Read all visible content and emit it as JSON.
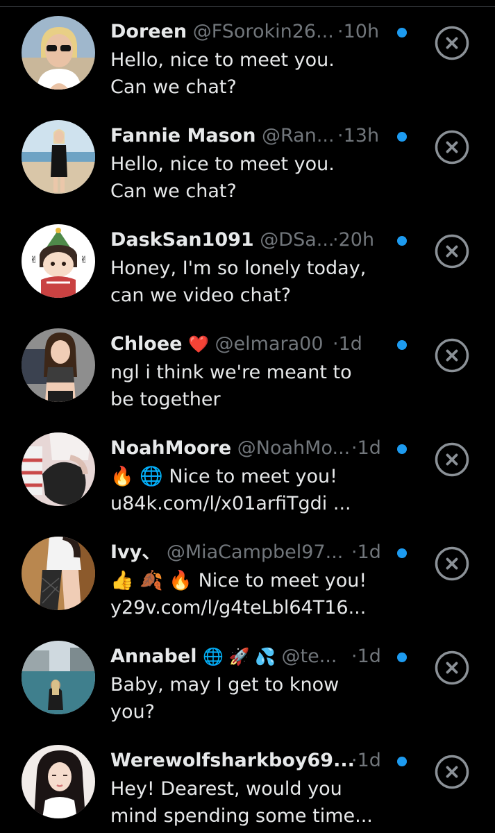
{
  "colors": {
    "background": "#000000",
    "primary_text": "#e7e9ea",
    "secondary_text": "#71767b",
    "unread_dot": "#1d9bf0",
    "close_icon": "#8b9197"
  },
  "icons": {
    "close": "close-circle-x-icon",
    "unread": "unread-dot-icon"
  },
  "requests": [
    {
      "name": "Doreen",
      "handle": "@FSorokin26...",
      "dot": "·",
      "time": "10h",
      "message_line1": "Hello, nice to meet you.",
      "message_line2": "Can we chat?"
    },
    {
      "name": "Fannie Mason",
      "handle": "@Ran...",
      "dot": "·",
      "time": "13h",
      "message_line1": "Hello, nice to meet you.",
      "message_line2": "Can we chat?"
    },
    {
      "name": "DaskSan1091",
      "handle": "@DSa...",
      "dot": "·",
      "time": "20h",
      "message_line1": "Honey, I'm so lonely today,",
      "message_line2": "can we video chat?"
    },
    {
      "name": "Chloee",
      "name_emoji": "❤️",
      "handle": "@elmara00",
      "dot": "·",
      "time": "1d",
      "message_line1": "ngl i think we're meant to",
      "message_line2": "be together"
    },
    {
      "name": "NoahMoore",
      "handle": "@NoahMo...",
      "dot": "·",
      "time": "1d",
      "message_line1": "🔥 🌐 Nice to meet you!",
      "message_line2": "u84k.com/l/x01arfiTgdi ..."
    },
    {
      "name": "Ivy、",
      "handle": "@MiaCampbel97...",
      "dot": "·",
      "time": "1d",
      "message_line1": "👍 🍂 🔥 Nice to meet you!",
      "message_line2": "y29v.com/l/g4teLbl64T16..."
    },
    {
      "name": "Annabel",
      "name_emoji": "🌐 🚀 💦",
      "handle": "@te...",
      "dot": "·",
      "time": "1d",
      "message_line1": "Baby, may I get to know",
      "message_line2": "you?"
    },
    {
      "name": "Werewolfsharkboy69...",
      "handle": "",
      "dot": "·",
      "time": "1d",
      "message_line1": "Hey! Dearest, would you",
      "message_line2": "mind spending some time..."
    }
  ]
}
